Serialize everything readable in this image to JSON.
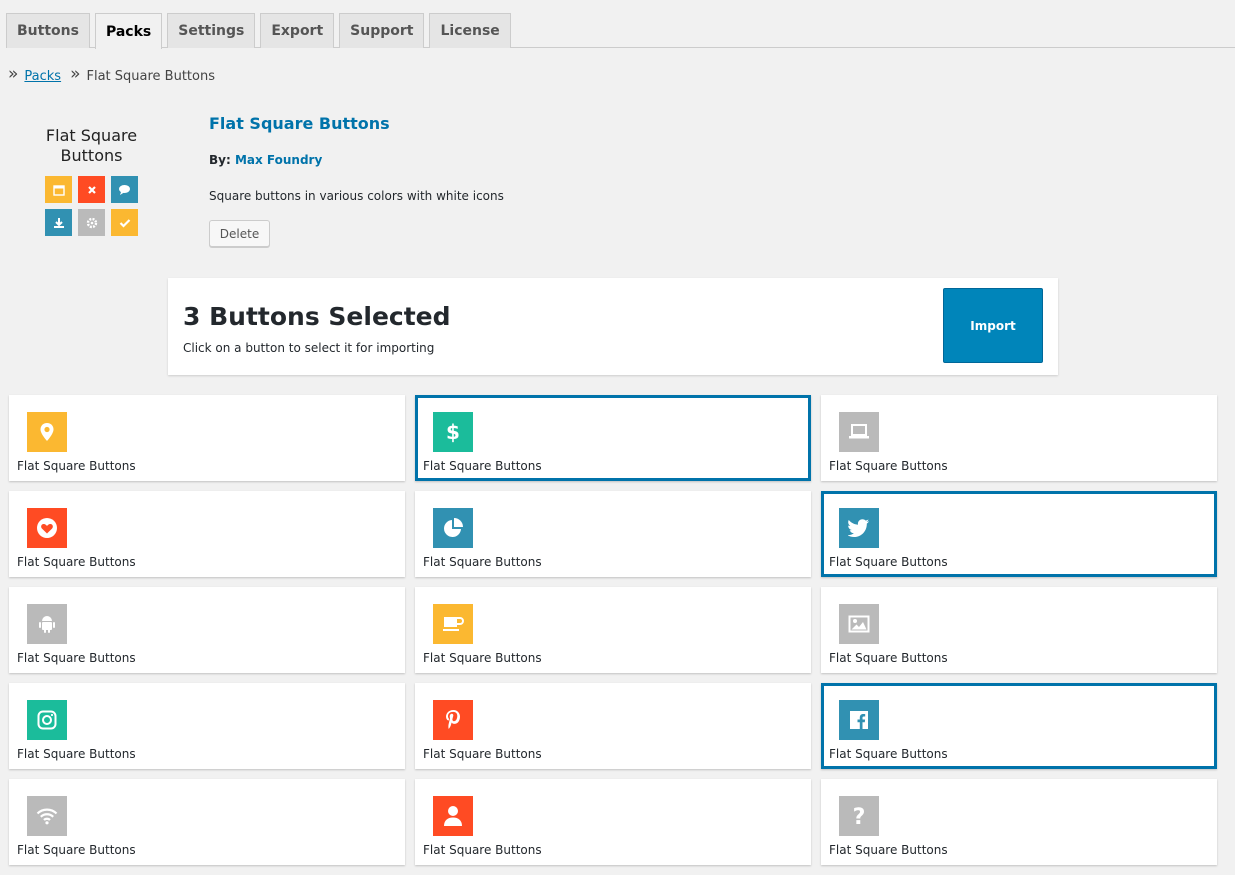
{
  "tabs": [
    {
      "label": "Buttons",
      "active": false
    },
    {
      "label": "Packs",
      "active": true
    },
    {
      "label": "Settings",
      "active": false
    },
    {
      "label": "Export",
      "active": false
    },
    {
      "label": "Support",
      "active": false
    },
    {
      "label": "License",
      "active": false
    }
  ],
  "breadcrumb": {
    "separator": "»",
    "parent": "Packs",
    "current": "Flat Square Buttons"
  },
  "pack": {
    "thumb_title_line1": "Flat Square",
    "thumb_title_line2": "Buttons",
    "title": "Flat Square Buttons",
    "by_label": "By:",
    "author": "Max Foundry",
    "description": "Square buttons in various colors with white icons",
    "delete_label": "Delete"
  },
  "selection": {
    "count_text": "3 Buttons Selected",
    "hint": "Click on a button to select it for importing",
    "import_label": "Import"
  },
  "colors": {
    "yellow": "#fbb831",
    "green": "#1bbc9b",
    "gray": "#bababa",
    "red": "#ff4b23",
    "teal": "#3191b2",
    "accent": "#0073aa",
    "import": "#0085ba"
  },
  "cards": [
    {
      "label": "Flat Square Buttons",
      "icon": "map-marker-icon",
      "color": "#fbb831",
      "selected": false
    },
    {
      "label": "Flat Square Buttons",
      "icon": "dollar-icon",
      "color": "#1bbc9b",
      "selected": true
    },
    {
      "label": "Flat Square Buttons",
      "icon": "laptop-icon",
      "color": "#bababa",
      "selected": false
    },
    {
      "label": "Flat Square Buttons",
      "icon": "heart-icon",
      "color": "#ff4b23",
      "selected": false
    },
    {
      "label": "Flat Square Buttons",
      "icon": "pie-chart-icon",
      "color": "#3191b2",
      "selected": false
    },
    {
      "label": "Flat Square Buttons",
      "icon": "twitter-icon",
      "color": "#3191b2",
      "selected": true
    },
    {
      "label": "Flat Square Buttons",
      "icon": "android-icon",
      "color": "#bababa",
      "selected": false
    },
    {
      "label": "Flat Square Buttons",
      "icon": "coffee-icon",
      "color": "#fbb831",
      "selected": false
    },
    {
      "label": "Flat Square Buttons",
      "icon": "image-icon",
      "color": "#bababa",
      "selected": false
    },
    {
      "label": "Flat Square Buttons",
      "icon": "instagram-icon",
      "color": "#1bbc9b",
      "selected": false
    },
    {
      "label": "Flat Square Buttons",
      "icon": "pinterest-icon",
      "color": "#ff4b23",
      "selected": false
    },
    {
      "label": "Flat Square Buttons",
      "icon": "facebook-icon",
      "color": "#3191b2",
      "selected": true
    },
    {
      "label": "Flat Square Buttons",
      "icon": "wifi-icon",
      "color": "#bababa",
      "selected": false
    },
    {
      "label": "Flat Square Buttons",
      "icon": "user-icon",
      "color": "#ff4b23",
      "selected": false
    },
    {
      "label": "Flat Square Buttons",
      "icon": "question-icon",
      "color": "#bababa",
      "selected": false
    }
  ]
}
